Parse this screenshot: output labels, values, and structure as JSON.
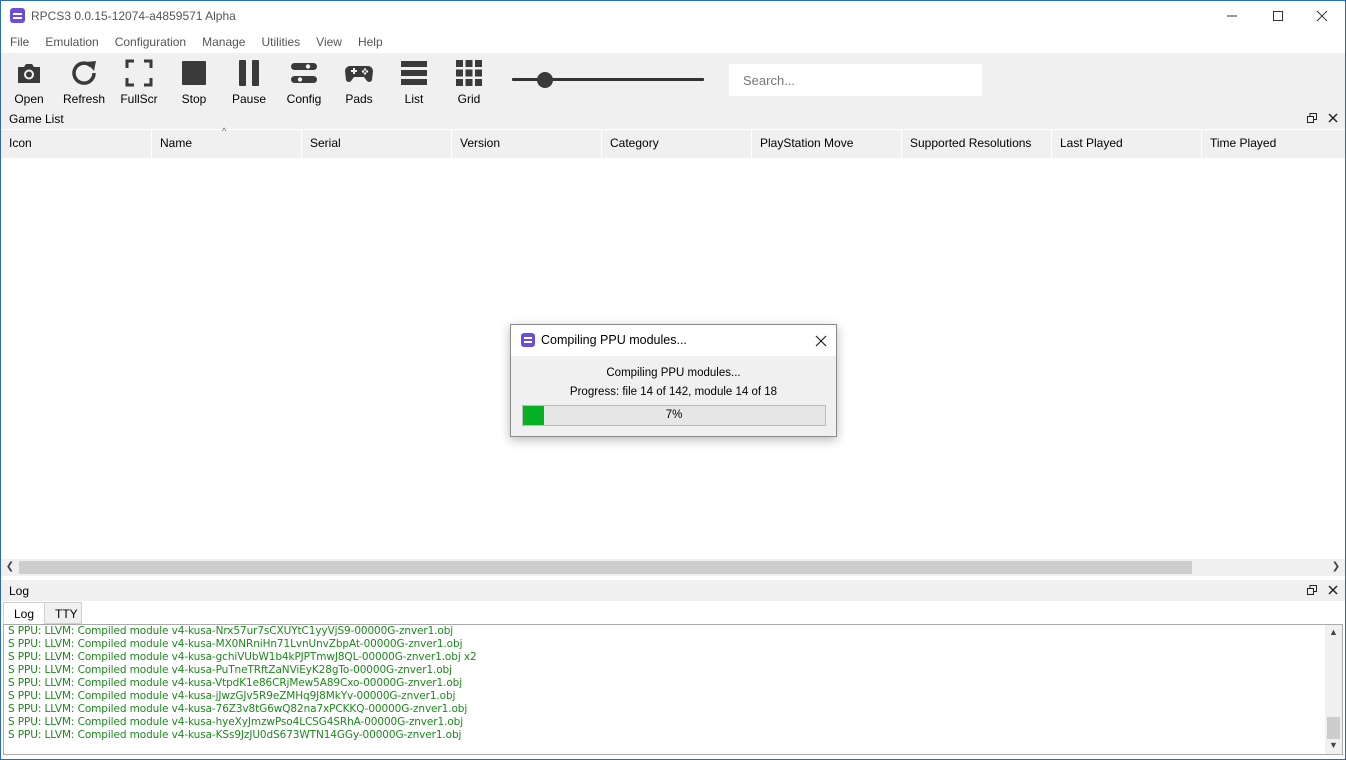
{
  "window": {
    "title": "RPCS3 0.0.15-12074-a4859571 Alpha"
  },
  "menu": [
    "File",
    "Emulation",
    "Configuration",
    "Manage",
    "Utilities",
    "View",
    "Help"
  ],
  "toolbar": {
    "open": "Open",
    "refresh": "Refresh",
    "fullscr": "FullScr",
    "stop": "Stop",
    "pause": "Pause",
    "config": "Config",
    "pads": "Pads",
    "list": "List",
    "grid": "Grid",
    "search_placeholder": "Search...",
    "icon_size_slider_fraction": 0.17
  },
  "game_list": {
    "title": "Game List",
    "columns": [
      "Icon",
      "Name",
      "Serial",
      "Version",
      "Category",
      "PlayStation Move",
      "Supported Resolutions",
      "Last Played",
      "Time Played"
    ],
    "sort_indicator": "^"
  },
  "log_panel": {
    "title": "Log",
    "tabs": [
      "Log",
      "TTY"
    ],
    "lines": [
      "S PPU: LLVM: Compiled module v4-kusa-Nrx57ur7sCXUYtC1yyVjS9-00000G-znver1.obj",
      "S PPU: LLVM: Compiled module v4-kusa-MX0NRniHn71LvnUnvZbpAt-00000G-znver1.obj",
      "S PPU: LLVM: Compiled module v4-kusa-gchiVUbW1b4kPJPTmwJ8QL-00000G-znver1.obj x2",
      "S PPU: LLVM: Compiled module v4-kusa-PuTneTRftZaNViEyK28gTo-00000G-znver1.obj",
      "S PPU: LLVM: Compiled module v4-kusa-VtpdK1e86CRjMew5A89Cxo-00000G-znver1.obj",
      "S PPU: LLVM: Compiled module v4-kusa-jJwzGJv5R9eZMHq9J8MkYv-00000G-znver1.obj",
      "S PPU: LLVM: Compiled module v4-kusa-76Z3v8tG6wQ82na7xPCKKQ-00000G-znver1.obj",
      "S PPU: LLVM: Compiled module v4-kusa-hyeXyJmzwPso4LCSG4SRhA-00000G-znver1.obj",
      "S PPU: LLVM: Compiled module v4-kusa-KSs9JzJU0dS673WTN14GGy-00000G-znver1.obj"
    ]
  },
  "dialog": {
    "title": "Compiling PPU modules...",
    "message": "Compiling PPU modules...",
    "progress_text": "Progress: file 14 of 142, module 14 of 18",
    "percent_label": "7%",
    "progress_fraction": 0.07,
    "fill_color": "#06b025"
  },
  "colors": {
    "accent": "#6b4fd8",
    "log_text": "#1a8a1a"
  }
}
